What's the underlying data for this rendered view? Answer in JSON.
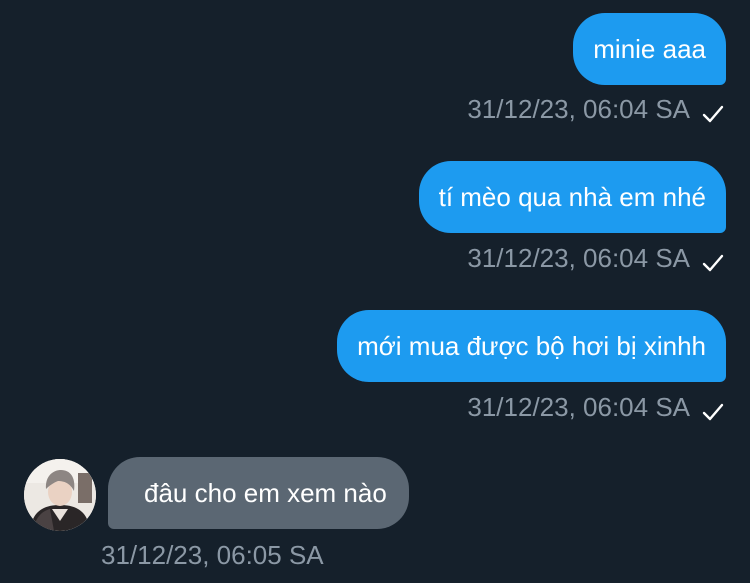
{
  "messages": [
    {
      "direction": "outgoing",
      "text": "minie aaa",
      "time": "31/12/23, 06:04 SA",
      "status_icon": "checkmark-icon"
    },
    {
      "direction": "outgoing",
      "text": "tí mèo qua nhà em nhé",
      "time": "31/12/23, 06:04 SA",
      "status_icon": "checkmark-icon"
    },
    {
      "direction": "outgoing",
      "text": "mới mua được bộ hơi bị xinhh",
      "time": "31/12/23, 06:04 SA",
      "status_icon": "checkmark-icon"
    },
    {
      "direction": "incoming",
      "text": "đâu cho em xem nào",
      "time": "31/12/23, 06:05 SA",
      "avatar": "contact-avatar"
    }
  ],
  "colors": {
    "background": "#15202b",
    "outgoing_bubble": "#1d9bf0",
    "incoming_bubble": "#5b6773",
    "timestamp": "#8b98a5",
    "text": "#ffffff"
  }
}
